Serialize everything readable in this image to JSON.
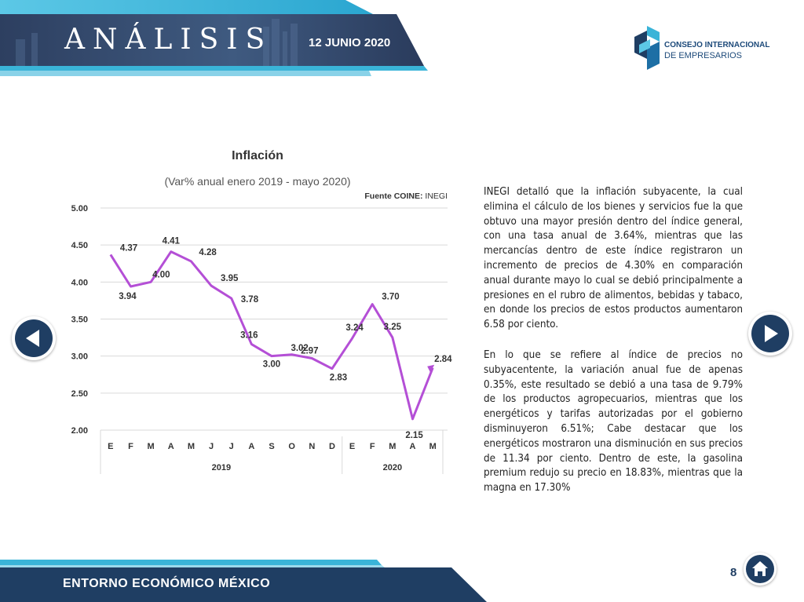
{
  "header": {
    "title": "ANÁLISIS",
    "date": "12 JUNIO 2020"
  },
  "logo": {
    "line1": "CONSEJO INTERNACIONAL",
    "line2": "DE EMPRESARIOS"
  },
  "chart_data": {
    "type": "line",
    "title": "Inflación",
    "subtitle": "(Var% anual enero 2019 - mayo 2020)",
    "source_label": "Fuente COINE:",
    "source_value": "INEGI",
    "categories": [
      "E",
      "F",
      "M",
      "A",
      "M",
      "J",
      "J",
      "A",
      "S",
      "O",
      "N",
      "D",
      "E",
      "F",
      "M",
      "A",
      "M"
    ],
    "year_groups": [
      {
        "label": "2019",
        "count": 12
      },
      {
        "label": "2020",
        "count": 5
      }
    ],
    "values": [
      4.37,
      3.94,
      4.0,
      4.41,
      4.28,
      3.95,
      3.78,
      3.16,
      3.0,
      3.02,
      2.97,
      2.83,
      3.24,
      3.7,
      3.25,
      2.15,
      2.84
    ],
    "value_labels": [
      "4.37",
      "3.94",
      "4.00",
      "4.41",
      "4.28",
      "3.95",
      "3.78",
      "3.16",
      "3.00",
      "3.02",
      "2.97",
      "2.83",
      "3.24",
      "3.70",
      "3.25",
      "2.15",
      "2.84"
    ],
    "yticks": [
      "5.00",
      "4.50",
      "4.00",
      "3.50",
      "3.00",
      "2.50",
      "2.00"
    ],
    "ylim": [
      2.0,
      5.0
    ],
    "grid": true,
    "line_color": "#b44fd6"
  },
  "article": {
    "p1": "INEGI detalló que la inflación subyacente, la cual elimina el cálculo de los bienes y servicios fue la que obtuvo una mayor presión dentro del índice general, con una tasa anual de 3.64%, mientras que las mercancías dentro de este índice registraron un incremento de precios de 4.30% en comparación anual durante mayo lo cual se debió principalmente a presiones en el rubro de alimentos, bebidas y tabaco, en donde los precios de estos productos aumentaron 6.58 por ciento.",
    "p2": "En lo que se refiere al índice de precios no subyacentente, la variación anual fue de apenas 0.35%, este resultado se debió a una tasa de 9.79% de los productos agropecuarios, mientras que los energéticos y tarifas autorizadas por el gobierno disminuyeron 6.51%; Cabe destacar que los energéticos mostraron una disminución en sus precios de 11.34 por ciento. Dentro de este, la gasolina premium redujo su precio en 18.83%, mientras que la magna en 17.30%"
  },
  "footer": {
    "label": "ENTORNO ECONÓMICO MÉXICO",
    "page": "8"
  },
  "icons": {
    "prev": "arrow-left-icon",
    "next": "arrow-right-icon",
    "home": "home-icon"
  },
  "colors": {
    "navy": "#1f3e63",
    "cyan": "#3ab4d8",
    "line": "#b44fd6"
  }
}
